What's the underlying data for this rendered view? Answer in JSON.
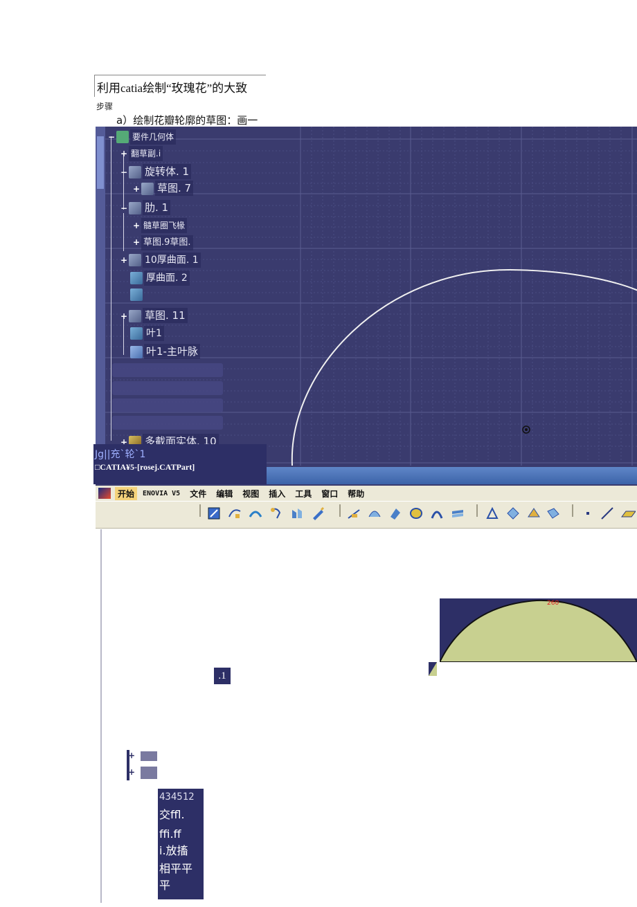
{
  "document": {
    "title": "利用catia绘制“玫瑰花”的大致",
    "steps_label": "步骤",
    "step_a": "a）绘制花瓣轮廓的草图：画一"
  },
  "tree": {
    "items": [
      {
        "label": "要件几何体"
      },
      {
        "label": "翻草副.i"
      },
      {
        "label": "旋转体. 1"
      },
      {
        "label": "草图. 7"
      },
      {
        "label": "肋. 1"
      },
      {
        "label": "髓草圈飞椽"
      },
      {
        "label": "草图.9草图."
      },
      {
        "label": "10厚曲面. 1"
      },
      {
        "label": "厚曲面. 2"
      },
      {
        "label": "草图. 11"
      },
      {
        "label": "叶1"
      },
      {
        "label": "叶1-主叶脉"
      },
      {
        "label": "多截面实体. 10"
      }
    ]
  },
  "status": {
    "line1": "Jg||充`轮`1",
    "line2": "□CATIA¥5-[rosej.CATPart]"
  },
  "menu": {
    "items": [
      "开始",
      "ENOVIA V5",
      "文件",
      "编辑",
      "视图",
      "插入",
      "工具",
      "窗口",
      "帮助"
    ]
  },
  "toolbar": {
    "icons": [
      "sketch-icon",
      "spline-icon",
      "arc-icon",
      "sweep-icon",
      "pad-icon",
      "edit-icon",
      "line-icon",
      "surface-icon",
      "extrude-icon",
      "revolve-icon",
      "loft-icon",
      "fill-icon",
      "join-icon",
      "split-icon",
      "trim-icon",
      "split-2-icon",
      "point-icon",
      "line-tool-icon",
      "plane-icon"
    ]
  },
  "labels": {
    "panel_mark": "260",
    "point_label": ".1"
  },
  "textbox": {
    "lines": [
      "434512",
      "交ffl.",
      "ffi.ff",
      "i.放搐",
      "相平平",
      "平"
    ]
  },
  "colors": {
    "viewport_bg": "#3a3b6e",
    "panel_fill": "#c8d090",
    "window_title": "#4a72b8"
  }
}
